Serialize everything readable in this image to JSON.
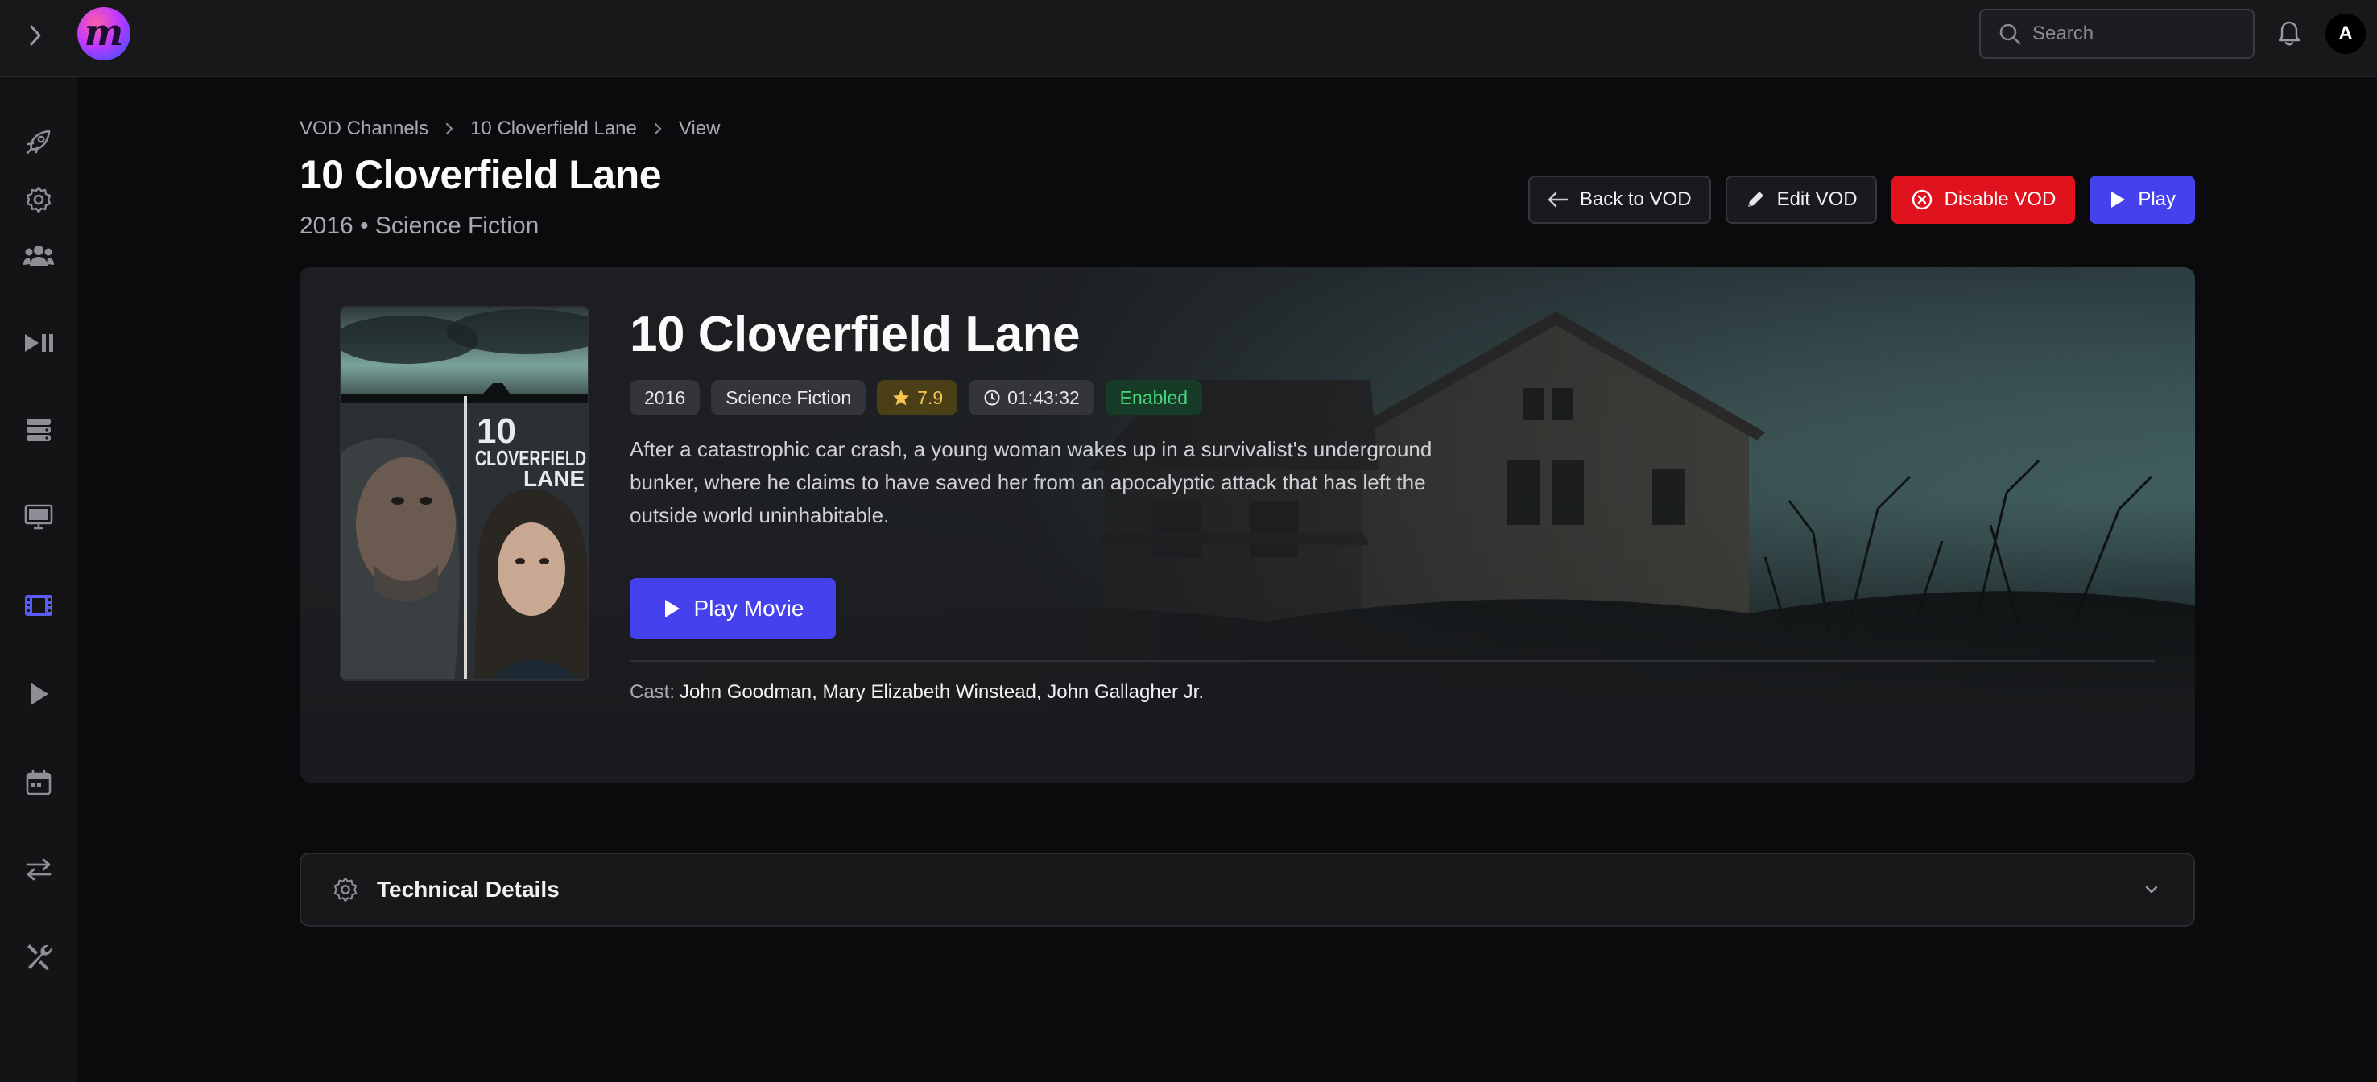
{
  "topbar": {
    "logo_letter": "m",
    "search_placeholder": "Search",
    "avatar_initial": "A"
  },
  "sidebar": {
    "items": [
      {
        "icon": "rocket-icon"
      },
      {
        "icon": "gear-icon"
      },
      {
        "icon": "users-icon"
      },
      {
        "icon": "play-pause-icon"
      },
      {
        "icon": "server-icon"
      },
      {
        "icon": "monitor-icon"
      },
      {
        "icon": "film-icon",
        "active": true
      },
      {
        "icon": "play-icon"
      },
      {
        "icon": "calendar-icon"
      },
      {
        "icon": "arrows-exchange-icon"
      },
      {
        "icon": "tools-icon"
      }
    ]
  },
  "breadcrumb": {
    "items": [
      "VOD Channels",
      "10 Cloverfield Lane",
      "View"
    ]
  },
  "header": {
    "title": "10 Cloverfield Lane",
    "subtitle": "2016 • Science Fiction"
  },
  "actions": {
    "back": "Back to VOD",
    "edit": "Edit VOD",
    "disable": "Disable VOD",
    "play": "Play"
  },
  "movie": {
    "title": "10 Cloverfield Lane",
    "year": "2016",
    "genre": "Science Fiction",
    "rating": "7.9",
    "duration": "01:43:32",
    "status": "Enabled",
    "description": "After a catastrophic car crash, a young woman wakes up in a survivalist's underground bunker, where he claims to have saved her from an apocalyptic attack that has left the outside world uninhabitable.",
    "play_label": "Play Movie",
    "cast_label": "Cast:",
    "cast": "John Goodman, Mary Elizabeth Winstead, John Gallagher Jr.",
    "poster_title_line1": "10",
    "poster_title_line2": "CLOVERFIELD",
    "poster_title_line3": "LANE"
  },
  "technical": {
    "label": "Technical Details"
  },
  "colors": {
    "accent": "#4541ec",
    "danger": "#e0121e",
    "enabled": "#4ad37f",
    "rating": "#f5c451"
  }
}
